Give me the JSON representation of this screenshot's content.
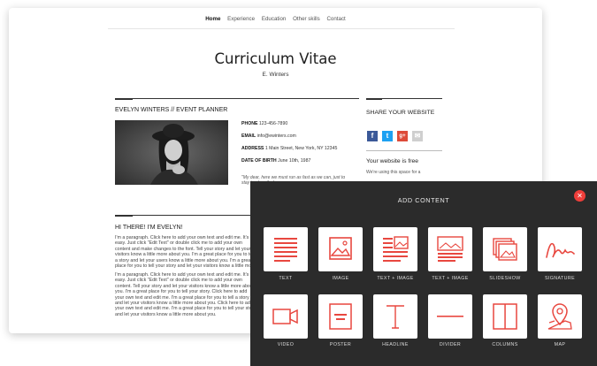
{
  "nav": {
    "items": [
      "Home",
      "Experience",
      "Education",
      "Other skills",
      "Contact"
    ]
  },
  "cv": {
    "title": "Curriculum Vitae",
    "subtitle": "E. Winters",
    "heading": "EVELYN WINTERS // EVENT PLANNER",
    "info": [
      {
        "label": "PHONE",
        "value": "123-456-7890"
      },
      {
        "label": "EMAIL",
        "value": "info@ewinters.com"
      },
      {
        "label": "ADDRESS",
        "value": "1 Main Street, New York, NY 12345"
      },
      {
        "label": "DATE OF BIRTH",
        "value": "June 10th, 1987"
      }
    ],
    "quote": "\"My dear, here we must run as fast as we can, just to stay in place.\" - L",
    "hello_heading": "HI THERE! I'M EVELYN!",
    "para1": "I'm a paragraph. Click here to add your own text and edit me. It's easy. Just click \"Edit Text\" or double click me to add your own content and make changes to the font. Tell your story and let your visitors know a little more about you. I'm a great place for you to tell a story and let your users know a little more about you. I'm a great place for you to tell your story and let your visitors know a little more about you.",
    "para2": "I'm a paragraph. Click here to add your own text and edit me. It's easy. Just click \"Edit Text\" or double click me to add your own content. Tell your story and let your visitors know a little more about you. I'm a great place for you to tell your story. Click here to add your own text and edit me. I'm a great place for you to tell a story and let your visitors know a little more about you. Click here to add your own text and edit me. I'm a great place for you to tell your story and let your visitors know a little more about you."
  },
  "sidebar": {
    "share_heading": "SHARE YOUR WEBSITE",
    "social": [
      {
        "icon": "facebook-icon",
        "glyph": "f",
        "color": "#3b5998"
      },
      {
        "icon": "twitter-icon",
        "glyph": "t",
        "color": "#1da1f2"
      },
      {
        "icon": "google-plus-icon",
        "glyph": "g+",
        "color": "#dd4b39"
      },
      {
        "icon": "email-icon",
        "glyph": "✉",
        "color": "#cfcfcf"
      }
    ],
    "free_heading": "Your website is free",
    "free_text": "We're using this space for a"
  },
  "panel": {
    "title": "ADD CONTENT",
    "accent": "#e8473f",
    "tiles": [
      {
        "label": "TEXT",
        "icon": "text-icon"
      },
      {
        "label": "IMAGE",
        "icon": "image-icon"
      },
      {
        "label": "TEXT + IMAGE",
        "icon": "text-image-icon"
      },
      {
        "label": "TEXT + IMAGE",
        "icon": "image-text-icon"
      },
      {
        "label": "SLIDESHOW",
        "icon": "slideshow-icon"
      },
      {
        "label": "SIGNATURE",
        "icon": "signature-icon"
      },
      {
        "label": "VIDEO",
        "icon": "video-icon"
      },
      {
        "label": "POSTER",
        "icon": "poster-icon"
      },
      {
        "label": "HEADLINE",
        "icon": "headline-icon"
      },
      {
        "label": "DIVIDER",
        "icon": "divider-icon"
      },
      {
        "label": "COLUMNS",
        "icon": "columns-icon"
      },
      {
        "label": "MAP",
        "icon": "map-pin-icon"
      }
    ]
  }
}
